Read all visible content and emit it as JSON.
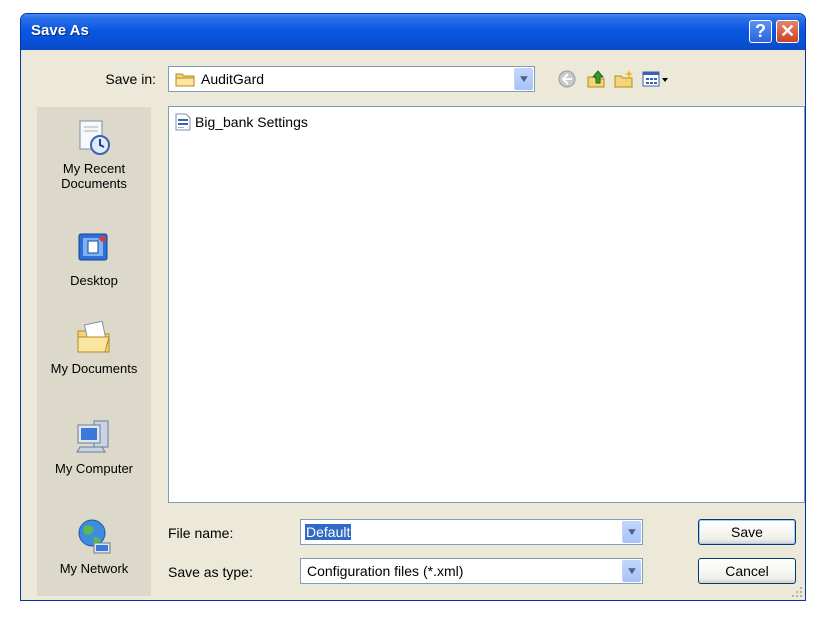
{
  "window": {
    "title": "Save As",
    "help_label": "?",
    "close_label": "✕"
  },
  "save_in": {
    "label": "Save in:",
    "value": "AuditGard"
  },
  "toolbar": {
    "icons": [
      "back-icon",
      "up-folder-icon",
      "new-folder-icon",
      "view-menu-icon"
    ]
  },
  "places": [
    {
      "label": "My Recent Documents",
      "icon": "recent-documents-icon"
    },
    {
      "label": "Desktop",
      "icon": "desktop-icon"
    },
    {
      "label": "My Documents",
      "icon": "my-documents-icon"
    },
    {
      "label": "My Computer",
      "icon": "my-computer-icon"
    },
    {
      "label": "My Network",
      "icon": "my-network-icon"
    }
  ],
  "files": [
    {
      "name": "Big_bank Settings",
      "icon": "settings-file-icon"
    }
  ],
  "file_name": {
    "label": "File name:",
    "value": "Default"
  },
  "file_type": {
    "label": "Save as type:",
    "value": "Configuration files (*.xml)"
  },
  "buttons": {
    "save": "Save",
    "cancel": "Cancel"
  },
  "colors": {
    "title_bar": "#0a58e0",
    "dialog_bg": "#ece9d8",
    "selection": "#316ac5"
  }
}
